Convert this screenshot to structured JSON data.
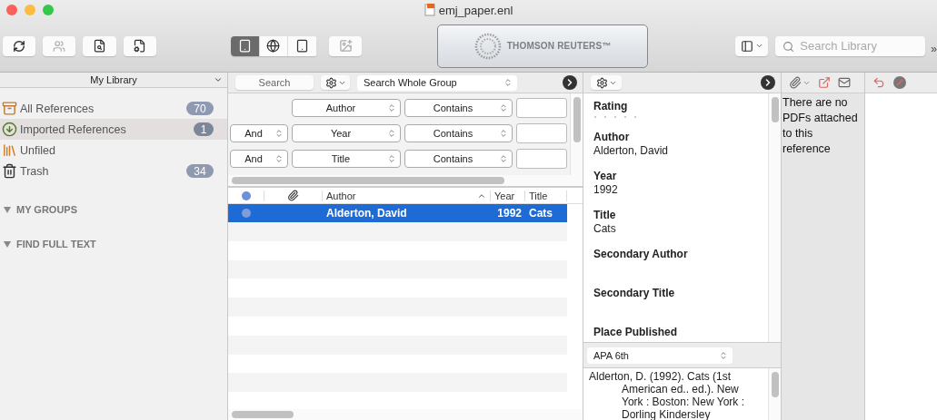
{
  "window": {
    "title": "emj_paper.enl"
  },
  "toolbar": {
    "logo": "THOMSON REUTERS™",
    "search": {
      "placeholder": "Search Library"
    },
    "overflow": "»"
  },
  "sidebar": {
    "header": "My Library",
    "items": [
      {
        "label": "All References",
        "count": "70",
        "selected": false
      },
      {
        "label": "Imported References",
        "count": "1",
        "selected": true
      },
      {
        "label": "Unfiled",
        "selected": false
      },
      {
        "label": "Trash",
        "count": "34",
        "selected": false
      }
    ],
    "sections": [
      {
        "label": "MY GROUPS",
        "expanded": true
      },
      {
        "label": "FIND FULL TEXT",
        "expanded": true
      }
    ]
  },
  "search_bar": {
    "search_button": "Search",
    "scope": "Search Whole Group"
  },
  "search_rows": [
    {
      "field": "Author",
      "condition": "Contains"
    },
    {
      "operator": "And",
      "field": "Year",
      "condition": "Contains"
    },
    {
      "operator": "And",
      "field": "Title",
      "condition": "Contains"
    }
  ],
  "table": {
    "columns": [
      {
        "kind": "dot"
      },
      {
        "kind": "attachment"
      },
      {
        "kind": "text",
        "label": "Author",
        "sorted": true
      },
      {
        "kind": "text",
        "label": "Year"
      },
      {
        "kind": "text",
        "label": "Title"
      }
    ],
    "rows": [
      {
        "author": "Alderton, David",
        "year": "1992",
        "title": "Cats",
        "selected": true
      }
    ]
  },
  "reference": {
    "rating": {
      "label": "Rating",
      "stars": 0
    },
    "fields": [
      {
        "label": "Author",
        "value": "Alderton, David"
      },
      {
        "label": "Year",
        "value": "1992"
      },
      {
        "label": "Title",
        "value": "Cats"
      },
      {
        "label": "Secondary Author"
      },
      {
        "label": "Secondary Title"
      },
      {
        "label": "Place Published"
      }
    ],
    "style": "APA 6th",
    "citation": "Alderton, D. (1992). Cats (1st American ed.. ed.). New York : Boston: New York : Dorling Kindersley"
  },
  "pdf_panel": {
    "message": "There are no PDFs attached to this reference"
  }
}
